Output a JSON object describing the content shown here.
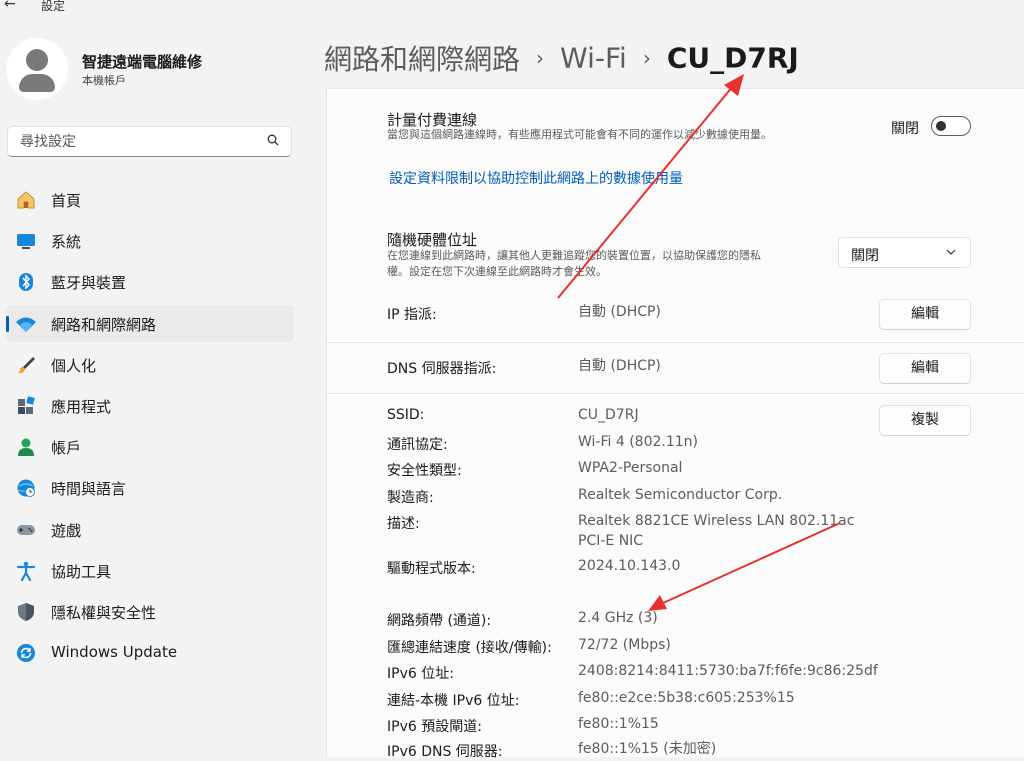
{
  "app": {
    "title": "設定"
  },
  "profile": {
    "name": "智捷遠端電腦維修",
    "account": "本機帳戶"
  },
  "search": {
    "placeholder": "尋找設定"
  },
  "nav": [
    {
      "label": "首頁",
      "icon": "home-icon"
    },
    {
      "label": "系統",
      "icon": "monitor-icon"
    },
    {
      "label": "藍牙與裝置",
      "icon": "bluetooth-icon"
    },
    {
      "label": "網路和網際網路",
      "icon": "wifi-icon",
      "active": true
    },
    {
      "label": "個人化",
      "icon": "brush-icon"
    },
    {
      "label": "應用程式",
      "icon": "apps-icon"
    },
    {
      "label": "帳戶",
      "icon": "person-icon"
    },
    {
      "label": "時間與語言",
      "icon": "globe-clock-icon"
    },
    {
      "label": "遊戲",
      "icon": "gamepad-icon"
    },
    {
      "label": "協助工具",
      "icon": "accessibility-icon"
    },
    {
      "label": "隱私權與安全性",
      "icon": "shield-icon"
    },
    {
      "label": "Windows Update",
      "icon": "update-icon"
    }
  ],
  "breadcrumb": {
    "level1": "網路和網際網路",
    "level2": "Wi-Fi",
    "current": "CU_D7RJ"
  },
  "metered": {
    "title": "計量付費連線",
    "desc": "當您與這個網路連線時，有些應用程式可能會有不同的運作以減少數據使用量。",
    "toggle_label": "關閉",
    "toggle_on": false
  },
  "data_limit_link": "設定資料限制以協助控制此網路上的數據使用量",
  "random_mac": {
    "title": "隨機硬體位址",
    "desc_line1": "在您連線到此網路時，讓其他人更難追蹤您的裝置位置，以協助保護您的隱私",
    "desc_line2": "權。設定在您下次連線至此網路時才會生效。",
    "value": "關閉"
  },
  "ip": {
    "label": "IP 指派:",
    "value": "自動 (DHCP)",
    "button": "編輯"
  },
  "dns": {
    "label": "DNS 伺服器指派:",
    "value": "自動 (DHCP)",
    "button": "編輯"
  },
  "copy_button": "複製",
  "properties": [
    {
      "label": "SSID:",
      "value": "CU_D7RJ"
    },
    {
      "label": "通訊協定:",
      "value": "Wi-Fi 4 (802.11n)"
    },
    {
      "label": "安全性類型:",
      "value": "WPA2-Personal"
    },
    {
      "label": "製造商:",
      "value": "Realtek Semiconductor Corp."
    },
    {
      "label": "描述:",
      "value": "Realtek 8821CE Wireless LAN 802.11ac PCI-E NIC"
    },
    {
      "label": "驅動程式版本:",
      "value": "2024.10.143.0"
    },
    {
      "label": "網路頻帶 (通道):",
      "value": "2.4 GHz (3)"
    },
    {
      "label": "匯總連結速度 (接收/傳輸):",
      "value": "72/72 (Mbps)"
    },
    {
      "label": "IPv6 位址:",
      "value": "2408:8214:8411:5730:ba7f:f6fe:9c86:25df"
    },
    {
      "label": "連結-本機 IPv6 位址:",
      "value": "fe80::e2ce:5b38:c605:253%15"
    },
    {
      "label": "IPv6 預設閘道:",
      "value": "fe80::1%15"
    },
    {
      "label": "IPv6 DNS 伺服器:",
      "value": "fe80::1%15 (未加密)"
    }
  ],
  "colors": {
    "accent": "#005fb8",
    "annotation_arrow": "#e8312f"
  }
}
